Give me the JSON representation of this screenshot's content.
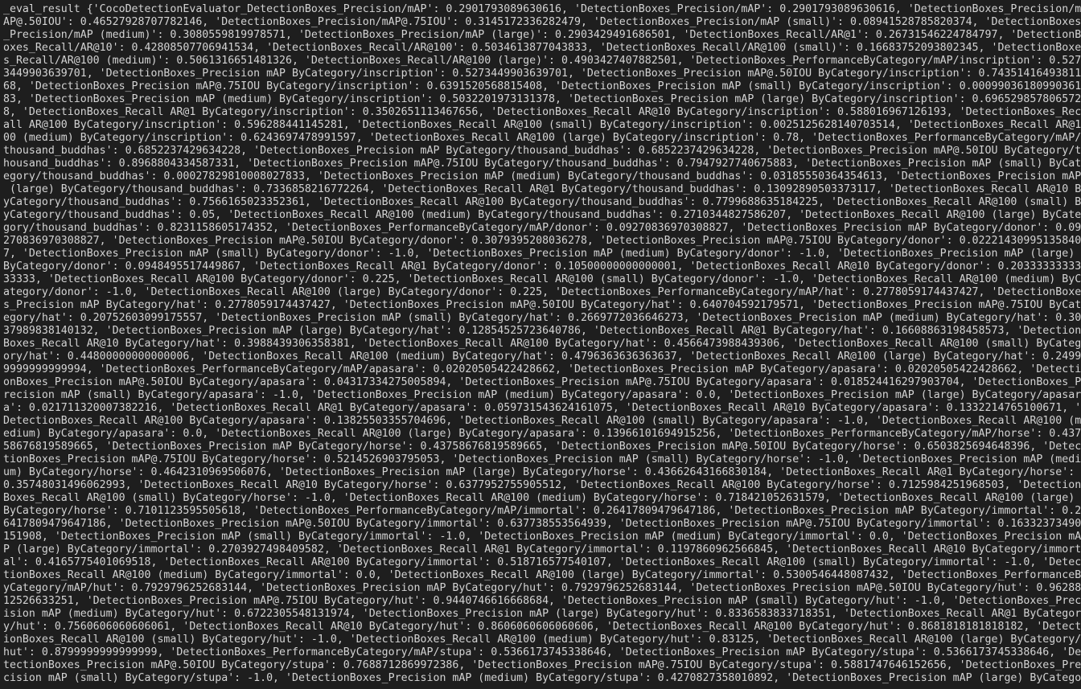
{
  "terminal": {
    "background": "#1e1e1e",
    "foreground": "#d4d4d4",
    "lines": [
      "_eval_result {'CocoDetectionEvaluator_DetectionBoxes_Precision/mAP': 0.2901793089630616, 'DetectionBoxes_Precision/mAP': 0.2901793089630616, 'DetectionBoxes_Precision/m",
      "AP@.50IOU': 0.46527928707782146, 'DetectionBoxes_Precision/mAP@.75IOU': 0.3145172336282479, 'DetectionBoxes_Precision/mAP (small)': 0.08941528785820374, 'DetectionBoxes",
      "_Precision/mAP (medium)': 0.3080559819978571, 'DetectionBoxes_Precision/mAP (large)': 0.2903429491686501, 'DetectionBoxes_Recall/AR@1': 0.26731546224784797, 'DetectionB",
      "oxes_Recall/AR@10': 0.42808507706941534, 'DetectionBoxes_Recall/AR@100': 0.5034613877043833, 'DetectionBoxes_Recall/AR@100 (small)': 0.16683752093802345, 'DetectionBoxe",
      "s_Recall/AR@100 (medium)': 0.5061316651481326, 'DetectionBoxes_Recall/AR@100 (large)': 0.4903427407882501, 'DetectionBoxes_PerformanceByCategory/mAP/inscription': 0.527",
      "3449903639701, 'DetectionBoxes_Precision mAP ByCategory/inscription': 0.5273449903639701, 'DetectionBoxes_Precision mAP@.50IOU ByCategory/inscription': 0.74351416493811",
      "68, 'DetectionBoxes_Precision mAP@.75IOU ByCategory/inscription': 0.6391520568815408, 'DetectionBoxes_Precision mAP (small) ByCategory/inscription': 0.00099036180990361",
      "83, 'DetectionBoxes_Precision mAP (medium) ByCategory/inscription': 0.5032201973131378, 'DetectionBoxes_Precision mAP (large) ByCategory/inscription': 0.696529857806572",
      "8, 'DetectionBoxes_Recall AR@1 ByCategory/inscription': 0.3502651113467656, 'DetectionBoxes_Recall AR@10 ByCategory/inscription': 0.588016967126193, 'DetectionBoxes_Rec",
      "all AR@100 ByCategory/inscription': 0.596288441145281, 'DetectionBoxes_Recall AR@100 (small) ByCategory/inscription': 0.0025125628140703514, 'DetectionBoxes_Recall AR@1",
      "00 (medium) ByCategory/inscription': 0.6243697478991597, 'DetectionBoxes_Recall AR@100 (large) ByCategory/inscription': 0.78, 'DetectionBoxes_PerformanceByCategory/mAP/",
      "thousand_buddhas': 0.6852237429634228, 'DetectionBoxes_Precision mAP ByCategory/thousand_buddhas': 0.6852237429634228, 'DetectionBoxes_Precision mAP@.50IOU ByCategory/t",
      "housand_buddhas': 0.8968804334587331, 'DetectionBoxes_Precision mAP@.75IOU ByCategory/thousand_buddhas': 0.7947927740675883, 'DetectionBoxes_Precision mAP (small) ByCat",
      "egory/thousand_buddhas': 0.00027829810008027833, 'DetectionBoxes_Precision mAP (medium) ByCategory/thousand_buddhas': 0.03185550364354613, 'DetectionBoxes_Precision mAP",
      " (large) ByCategory/thousand_buddhas': 0.7336858216772264, 'DetectionBoxes_Recall AR@1 ByCategory/thousand_buddhas': 0.13092890503373117, 'DetectionBoxes_Recall AR@10 B",
      "yCategory/thousand_buddhas': 0.7566165023352361, 'DetectionBoxes_Recall AR@100 ByCategory/thousand_buddhas': 0.7799688635184225, 'DetectionBoxes_Recall AR@100 (small) B",
      "yCategory/thousand_buddhas': 0.05, 'DetectionBoxes_Recall AR@100 (medium) ByCategory/thousand_buddhas': 0.2710344827586207, 'DetectionBoxes_Recall AR@100 (large) ByCate",
      "gory/thousand_buddhas': 0.8231158605174352, 'DetectionBoxes_PerformanceByCategory/mAP/donor': 0.09270836970308827, 'DetectionBoxes_Precision mAP ByCategory/donor': 0.09",
      "270836970308827, 'DetectionBoxes_Precision mAP@.50IOU ByCategory/donor': 0.3079395208036278, 'DetectionBoxes_Precision mAP@.75IOU ByCategory/donor': 0.02221430995135840",
      "7, 'DetectionBoxes_Precision mAP (small) ByCategory/donor': -1.0, 'DetectionBoxes_Precision mAP (medium) ByCategory/donor': -1.0, 'DetectionBoxes_Precision mAP (large) ",
      "ByCategory/donor': 0.0948495517449867, 'DetectionBoxes_Recall AR@1 ByCategory/donor': 0.10500000000000001, 'DetectionBoxes_Recall AR@10 ByCategory/donor': 0.20333333333",
      "33333, 'DetectionBoxes_Recall AR@100 ByCategory/donor': 0.225, 'DetectionBoxes_Recall AR@100 (small) ByCategory/donor': -1.0, 'DetectionBoxes_Recall AR@100 (medium) ByC",
      "ategory/donor': -1.0, 'DetectionBoxes_Recall AR@100 (large) ByCategory/donor': 0.225, 'DetectionBoxes_PerformanceByCategory/mAP/hat': 0.2778059174437427, 'DetectionBoxe",
      "s_Precision mAP ByCategory/hat': 0.2778059174437427, 'DetectionBoxes_Precision mAP@.50IOU ByCategory/hat': 0.640704592179571, 'DetectionBoxes_Precision mAP@.75IOU ByCat",
      "egory/hat': 0.20752603099175557, 'DetectionBoxes_Precision mAP (small) ByCategory/hat': 0.2669772036646273, 'DetectionBoxes_Precision mAP (medium) ByCategory/hat': 0.30",
      "37989838140132, 'DetectionBoxes_Precision mAP (large) ByCategory/hat': 0.12854525723640786, 'DetectionBoxes_Recall AR@1 ByCategory/hat': 0.16608863198458573, 'Detection",
      "Boxes_Recall AR@10 ByCategory/hat': 0.3988439306358381, 'DetectionBoxes_Recall AR@100 ByCategory/hat': 0.4566473988439306, 'DetectionBoxes_Recall AR@100 (small) ByCateg",
      "ory/hat': 0.44800000000000006, 'DetectionBoxes_Recall AR@100 (medium) ByCategory/hat': 0.4796363636363637, 'DetectionBoxes_Recall AR@100 (large) ByCategory/hat': 0.2499",
      "9999999999994, 'DetectionBoxes_PerformanceByCategory/mAP/apasara': 0.02020505422428662, 'DetectionBoxes_Precision mAP ByCategory/apasara': 0.02020505422428662, 'Detecti",
      "onBoxes_Precision mAP@.50IOU ByCategory/apasara': 0.04317334275005894, 'DetectionBoxes_Precision mAP@.75IOU ByCategory/apasara': 0.018524416297903704, 'DetectionBoxes_P",
      "recision mAP (small) ByCategory/apasara': -1.0, 'DetectionBoxes_Precision mAP (medium) ByCategory/apasara': 0.0, 'DetectionBoxes_Precision mAP (large) ByCategory/apasar",
      "a': 0.021711320007382216, 'DetectionBoxes_Recall AR@1 ByCategory/apasara': 0.059731543624161075, 'DetectionBoxes_Recall AR@10 ByCategory/apasara': 0.1332214765100671, '",
      "DetectionBoxes_Recall AR@100 ByCategory/apasara': 0.13825503355704696, 'DetectionBoxes_Recall AR@100 (small) ByCategory/apasara': -1.0, 'DetectionBoxes_Recall AR@100 (m",
      "edium) ByCategory/apasara': 0.0, 'DetectionBoxes_Recall AR@100 (large) ByCategory/apasara': 0.13966101694915256, 'DetectionBoxes_PerformanceByCategory/mAP/horse': 0.437",
      "58676819589665, 'DetectionBoxes_Precision mAP ByCategory/horse': 0.43758676819589665, 'DetectionBoxes_Precision mAP@.50IOU ByCategory/horse': 0.6503825694648396, 'Detec",
      "tionBoxes_Precision mAP@.75IOU ByCategory/horse': 0.5214526903795053, 'DetectionBoxes_Precision mAP (small) ByCategory/horse': -1.0, 'DetectionBoxes_Precision mAP (medi",
      "um) ByCategory/horse': 0.4642310969506076, 'DetectionBoxes_Precision mAP (large) ByCategory/horse': 0.43662643166830184, 'DetectionBoxes_Recall AR@1 ByCategory/horse': ",
      "0.35748031496062993, 'DetectionBoxes_Recall AR@10 ByCategory/horse': 0.6377952755905512, 'DetectionBoxes_Recall AR@100 ByCategory/horse': 0.7125984251968503, 'Detection",
      "Boxes_Recall AR@100 (small) ByCategory/horse': -1.0, 'DetectionBoxes_Recall AR@100 (medium) ByCategory/horse': 0.718421052631579, 'DetectionBoxes_Recall AR@100 (large) ",
      "ByCategory/horse': 0.7101123595505618, 'DetectionBoxes_PerformanceByCategory/mAP/immortal': 0.26417809479647186, 'DetectionBoxes_Precision mAP ByCategory/immortal': 0.2",
      "6417809479647186, 'DetectionBoxes_Precision mAP@.50IOU ByCategory/immortal': 0.637738553564939, 'DetectionBoxes_Precision mAP@.75IOU ByCategory/immortal': 0.16332373490",
      "151908, 'DetectionBoxes_Precision mAP (small) ByCategory/immortal': -1.0, 'DetectionBoxes_Precision mAP (medium) ByCategory/immortal': 0.0, 'DetectionBoxes_Precision mA",
      "P (large) ByCategory/immortal': 0.2703927498409582, 'DetectionBoxes_Recall AR@1 ByCategory/immortal': 0.1197860962566845, 'DetectionBoxes_Recall AR@10 ByCategory/immort",
      "al': 0.4165775401069518, 'DetectionBoxes_Recall AR@100 ByCategory/immortal': 0.518716577540107, 'DetectionBoxes_Recall AR@100 (small) ByCategory/immortal': -1.0, 'Detec",
      "tionBoxes_Recall AR@100 (medium) ByCategory/immortal': 0.0, 'DetectionBoxes_Recall AR@100 (large) ByCategory/immortal': 0.5300546448087432, 'DetectionBoxes_PerformanceB",
      "yCategory/mAP/hut': 0.7929796252683144, 'DetectionBoxes_Precision mAP ByCategory/hut': 0.7929796252683144, 'DetectionBoxes_Precision mAP@.50IOU ByCategory/hut': 0.96288",
      "12526633251, 'DetectionBoxes_Precision mAP@.75IOU ByCategory/hut': 0.9440746616668684, 'DetectionBoxes_Precision mAP (small) ByCategory/hut': -1.0, 'DetectionBoxes_Prec",
      "ision mAP (medium) ByCategory/hut': 0.6722305548131974, 'DetectionBoxes_Precision mAP (large) ByCategory/hut': 0.8336583833718351, 'DetectionBoxes_Recall AR@1 ByCategor",
      "y/hut': 0.7560606060606061, 'DetectionBoxes_Recall AR@10 ByCategory/hut': 0.8606060606060606, 'DetectionBoxes_Recall AR@100 ByCategory/hut': 0.8681818181818182, 'Detect",
      "ionBoxes_Recall AR@100 (small) ByCategory/hut': -1.0, 'DetectionBoxes_Recall AR@100 (medium) ByCategory/hut': 0.83125, 'DetectionBoxes_Recall AR@100 (large) ByCategory/",
      "hut': 0.8799999999999999, 'DetectionBoxes_PerformanceByCategory/mAP/stupa': 0.5366173745338646, 'DetectionBoxes_Precision mAP ByCategory/stupa': 0.5366173745338646, 'De",
      "tectionBoxes_Precision mAP@.50IOU ByCategory/stupa': 0.7688712869972386, 'DetectionBoxes_Precision mAP@.75IOU ByCategory/stupa': 0.5881747646152656, 'DetectionBoxes_Pre",
      "cision mAP (small) ByCategory/stupa': -1.0, 'DetectionBoxes_Precision mAP (medium) ByCategory/stupa': 0.4270827358010892, 'DetectionBoxes_Precision mAP (large) ByCatego"
    ]
  }
}
